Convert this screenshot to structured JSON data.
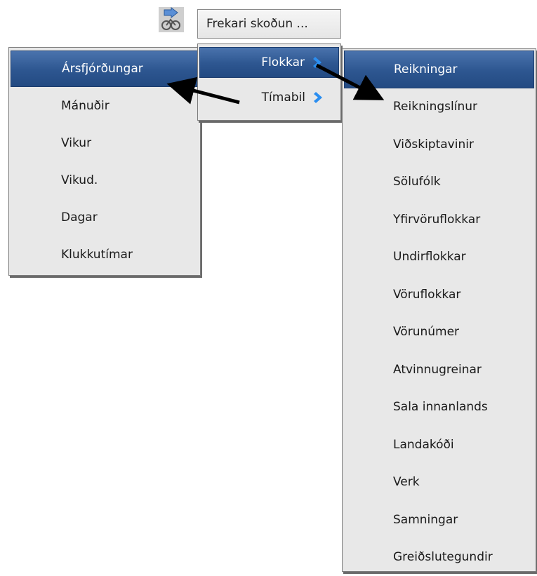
{
  "toolbar": {
    "more_views_label": "Frekari skoðun ...",
    "icon": "views-icon"
  },
  "left_menu": {
    "items": [
      {
        "label": "Ársfjórðungar",
        "selected": true
      },
      {
        "label": "Mánuðir"
      },
      {
        "label": "Vikur"
      },
      {
        "label": "Vikud."
      },
      {
        "label": "Dagar"
      },
      {
        "label": "Klukkutímar"
      }
    ]
  },
  "mid_menu": {
    "items": [
      {
        "label": "Flokkar",
        "selected": true,
        "has_submenu": true
      },
      {
        "label": "Tímabil",
        "has_submenu": true
      }
    ]
  },
  "right_menu": {
    "items": [
      {
        "label": "Reikningar",
        "selected": true
      },
      {
        "label": "Reikningslínur"
      },
      {
        "label": "Viðskiptavinir"
      },
      {
        "label": "Sölufólk"
      },
      {
        "label": "Yfirvöruflokkar"
      },
      {
        "label": "Undirflokkar"
      },
      {
        "label": "Vöruflokkar"
      },
      {
        "label": "Vörunúmer"
      },
      {
        "label": "Atvinnugreinar"
      },
      {
        "label": "Sala innanlands"
      },
      {
        "label": "Landakóði"
      },
      {
        "label": "Verk"
      },
      {
        "label": "Samningar"
      },
      {
        "label": "Greiðslutegundir"
      }
    ]
  },
  "colors": {
    "highlight": "#2d5690",
    "menu_bg": "#e8e8e8",
    "chevron": "#1e88e5"
  }
}
